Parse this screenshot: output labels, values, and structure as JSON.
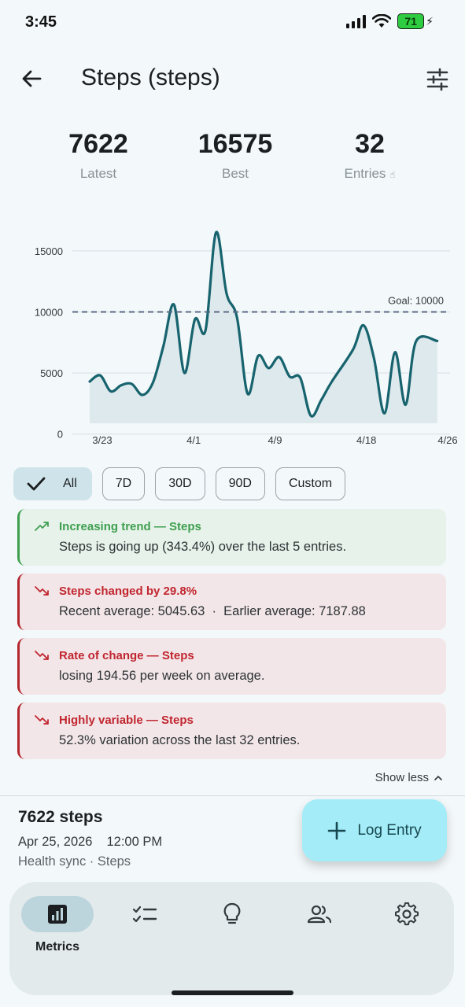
{
  "status_bar": {
    "time": "3:45",
    "battery": "71"
  },
  "app_bar": {
    "title": "Steps (steps)"
  },
  "stats": [
    {
      "value": "7622",
      "label": "Latest"
    },
    {
      "value": "16575",
      "label": "Best"
    },
    {
      "value": "32",
      "label": "Entries"
    }
  ],
  "chart_data": {
    "type": "area",
    "x_ticks": [
      "3/23",
      "4/1",
      "4/9",
      "4/18",
      "4/26"
    ],
    "y_ticks": [
      0,
      5000,
      10000,
      15000
    ],
    "ylim": [
      -1500,
      17500
    ],
    "goal": {
      "label": "Goal: 10000",
      "value": 10000
    },
    "series": [
      {
        "x": [
          "3/23",
          "3/24",
          "3/25",
          "3/26",
          "3/27",
          "3/28",
          "3/29",
          "3/30",
          "3/31",
          "4/1",
          "4/2",
          "4/3",
          "4/4",
          "4/5",
          "4/6",
          "4/7",
          "4/8",
          "4/9",
          "4/10",
          "4/11",
          "4/12",
          "4/13",
          "4/14",
          "4/15",
          "4/17",
          "4/18",
          "4/19",
          "4/20",
          "4/21",
          "4/22",
          "4/23",
          "4/25"
        ],
        "values": [
          4300,
          4800,
          3500,
          4000,
          4100,
          3200,
          4200,
          7200,
          10600,
          5000,
          9400,
          8500,
          16500,
          11500,
          9500,
          3300,
          6400,
          5400,
          6300,
          4700,
          4600,
          1500,
          2800,
          4300,
          6900,
          8900,
          6200,
          1700,
          6700,
          2400,
          7600,
          7622
        ]
      }
    ]
  },
  "filters": {
    "chips": [
      "All",
      "7D",
      "30D",
      "90D",
      "Custom"
    ],
    "selected": "All"
  },
  "insights": [
    {
      "tone": "positive",
      "title": "Increasing trend — Steps",
      "text": "Steps is going up (343.4%) over the last 5 entries."
    },
    {
      "tone": "negative",
      "title": "Steps changed by 29.8%",
      "text": "Recent average: 5045.63  ·  Earlier average: 7187.88"
    },
    {
      "tone": "negative",
      "title": "Rate of change — Steps",
      "text": "losing 194.56 per week on average."
    },
    {
      "tone": "negative",
      "title": "Highly variable — Steps",
      "text": "52.3% variation across the last 32 entries."
    }
  ],
  "show_less": "Show less",
  "latest_entry": {
    "value": "7622 steps",
    "date": "Apr 25, 2026",
    "time": "12:00 PM",
    "source": "Health sync · Steps"
  },
  "fab": {
    "label": "Log Entry"
  },
  "nav": {
    "items": [
      {
        "label": "Metrics",
        "icon": "bar-chart-icon",
        "active": true
      },
      {
        "label": "",
        "icon": "checklist-icon",
        "active": false
      },
      {
        "label": "",
        "icon": "lightbulb-icon",
        "active": false
      },
      {
        "label": "",
        "icon": "people-icon",
        "active": false
      },
      {
        "label": "",
        "icon": "settings-gear-icon",
        "active": false
      }
    ]
  },
  "colors": {
    "accent": "#17636e",
    "chart_fill": "#dde9ec",
    "positive": "#3f9f4f",
    "negative": "#c1262f",
    "fab": "#a4ecf8",
    "selected_chip": "#cfe4ea"
  }
}
